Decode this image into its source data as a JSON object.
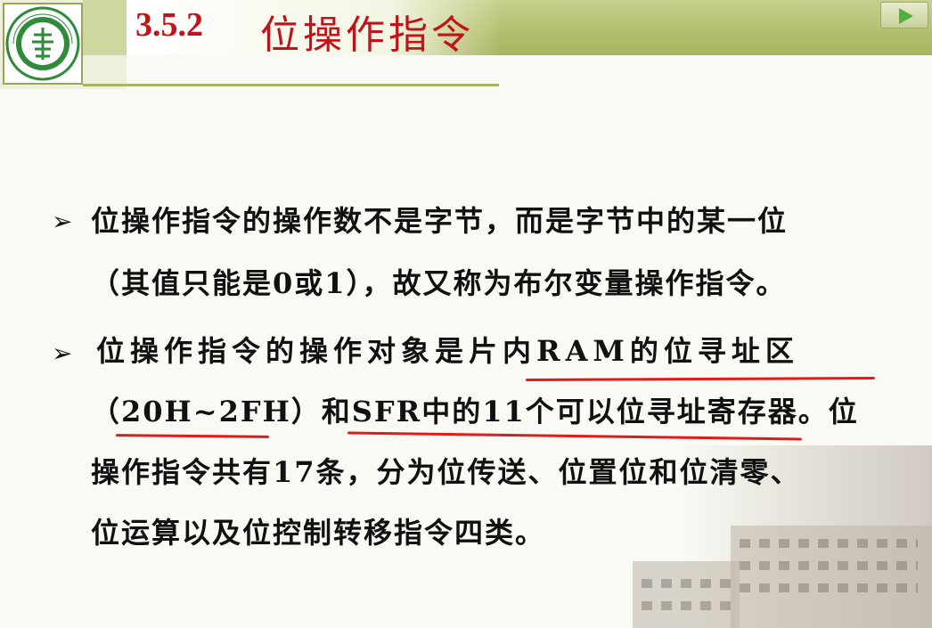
{
  "header": {
    "section_number": "3.5.2",
    "section_title": "位操作指令",
    "logo_text": "CHANG AN UNIVERSITY"
  },
  "icons": {
    "bullet": "arrowhead-bullet-icon",
    "nav": "play-arrow-icon",
    "logo": "university-seal-icon"
  },
  "colors": {
    "title": "#c0141b",
    "header_bar": "#b3bf6d",
    "underline": "#e01b1b"
  },
  "bullets": [
    {
      "line1": "位操作指令的操作数不是字节，而是字节中的某一位",
      "line2": "（其值只能是0或1），故又称为布尔变量操作指令。"
    },
    {
      "line1": "位操作指令的操作对象是片内RAM的位寻址区",
      "line2": "（20H~2FH）和SFR中的11个可以位寻址寄存器。位",
      "line3": "操作指令共有17条，分为位传送、位置位和位清零、",
      "line4": "位运算以及位控制转移指令四类。"
    }
  ]
}
